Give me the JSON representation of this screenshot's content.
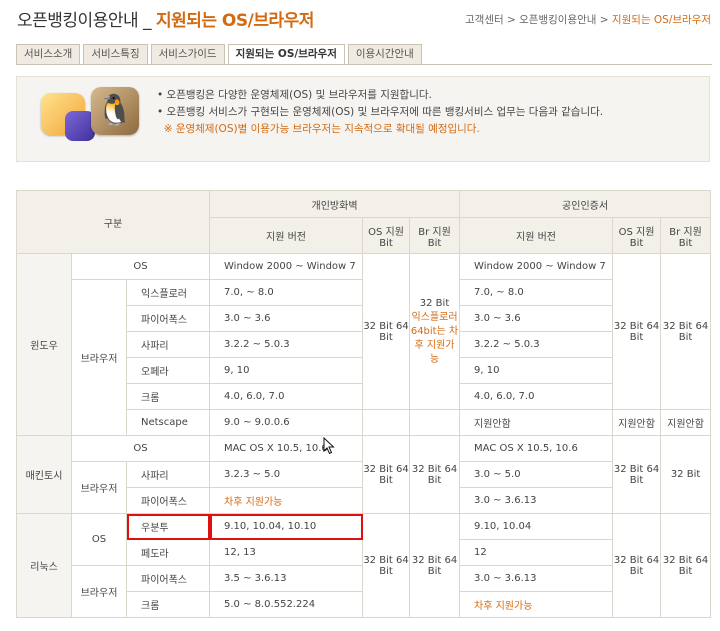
{
  "title": {
    "main": "오픈뱅킹이용안내",
    "sep": "_",
    "sub": "지원되는 OS/브라우저"
  },
  "breadcrumb": [
    "고객센터",
    "오픈뱅킹이용안내",
    "지원되는 OS/브라우저"
  ],
  "tabs": [
    "서비스소개",
    "서비스특징",
    "서비스가이드",
    "지원되는 OS/브라우저",
    "이용시간안내"
  ],
  "notice": [
    "오픈뱅킹은 다양한 운영체제(OS) 및 브라우저를 지원합니다.",
    "오픈뱅킹 서비스가 구현되는 운영체제(OS) 및 브라우저에 따른 뱅킹서비스 업무는 다음과 같습니다.",
    "※ 운영체제(OS)별 이용가능 브라우저는 지속적으로 확대될 예정입니다."
  ],
  "table": {
    "category": "구분",
    "group1": "개인방화벽",
    "group2": "공인인증서",
    "ver": "지원 버전",
    "os_bit": "OS 지원 Bit",
    "br_bit": "Br 지원 Bit",
    "os": "OS",
    "browser": "브라우저",
    "win": {
      "name": "윈도우",
      "os_fw": "Window 2000 ~ Window 7",
      "os_cert": "Window 2000 ~ Window 7",
      "rows": [
        {
          "name": "익스플로러",
          "fw": "7.0, ~ 8.0",
          "cert": "7.0, ~ 8.0"
        },
        {
          "name": "파이어폭스",
          "fw": "3.0 ~ 3.6",
          "cert": "3.0 ~ 3.6"
        },
        {
          "name": "사파리",
          "fw": "3.2.2 ~ 5.0.3",
          "cert": "3.2.2 ~ 5.0.3"
        },
        {
          "name": "오페라",
          "fw": "9, 10",
          "cert": "9, 10"
        },
        {
          "name": "크롬",
          "fw": "4.0, 6.0, 7.0",
          "cert": "4.0, 6.0, 7.0"
        },
        {
          "name": "Netscape",
          "fw": "9.0 ~ 9.0.0.6",
          "cert": "지원안함"
        }
      ],
      "fw_os_bit": "32 Bit 64 Bit",
      "fw_br_bit_top": "32 Bit",
      "fw_br_bit_note": "익스플로러 64bit는 차후 지원가능",
      "cert_os_bit": "32 Bit 64 Bit",
      "cert_br_bit": "32 Bit 64 Bit",
      "netscape_os_bit": "지원안함",
      "netscape_br_bit": "지원안함"
    },
    "mac": {
      "name": "매킨토시",
      "os_fw": "MAC OS X 10.5, 10.6",
      "os_cert": "MAC OS X 10.5, 10.6",
      "rows": [
        {
          "name": "사파리",
          "fw": "3.2.3 ~ 5.0",
          "cert": "3.0 ~ 5.0"
        },
        {
          "name": "파이어폭스",
          "fw": "차후 지원가능",
          "cert": "3.0 ~ 3.6.13"
        }
      ],
      "fw_os_bit": "32 Bit 64 Bit",
      "fw_br_bit": "32 Bit 64 Bit",
      "cert_os_bit": "32 Bit 64 Bit",
      "cert_br_bit": "32 Bit"
    },
    "linux": {
      "name": "리눅스",
      "os_rows": [
        {
          "name": "우분투",
          "fw": "9.10, 10.04, 10.10",
          "cert": "9.10, 10.04"
        },
        {
          "name": "페도라",
          "fw": "12, 13",
          "cert": "12"
        }
      ],
      "br_rows": [
        {
          "name": "파이어폭스",
          "fw": "3.5 ~ 3.6.13",
          "cert": "3.0 ~ 3.6.13"
        },
        {
          "name": "크롬",
          "fw": "5.0 ~ 8.0.552.224",
          "cert": "차후 지원가능"
        }
      ],
      "fw_os_bit": "32 Bit 64 Bit",
      "fw_br_bit": "32 Bit 64 Bit",
      "cert_os_bit": "32 Bit 64 Bit",
      "cert_br_bit": "32 Bit 64 Bit"
    }
  },
  "colors": {
    "accent": "#d36a12",
    "highlight": "#e01010",
    "header_bg": "#f3f0ea"
  }
}
